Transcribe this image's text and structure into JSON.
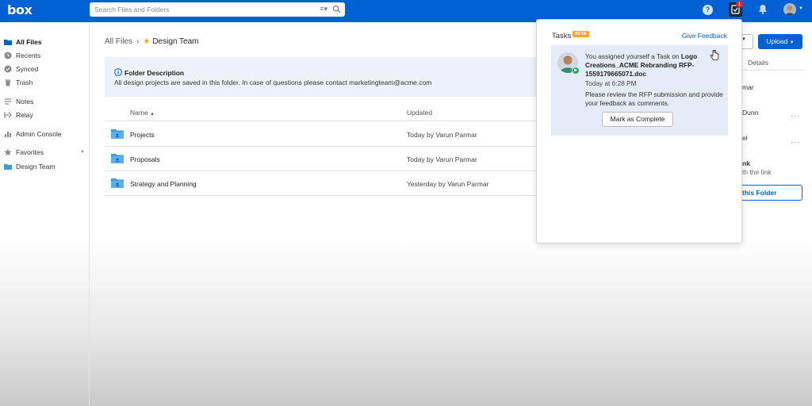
{
  "header": {
    "logo": "box",
    "search_placeholder": "Search Files and Folders",
    "tasks_count": "1",
    "help_label": "?"
  },
  "sidebar": {
    "items": [
      {
        "label": "All Files",
        "icon": "folder-icon",
        "active": true
      },
      {
        "label": "Recents",
        "icon": "clock-icon"
      },
      {
        "label": "Synced",
        "icon": "check-circle-icon"
      },
      {
        "label": "Trash",
        "icon": "trash-icon"
      },
      {
        "label": "Notes",
        "icon": "notes-icon"
      },
      {
        "label": "Relay",
        "icon": "relay-icon"
      },
      {
        "label": "Admin Console",
        "icon": "bar-chart-icon"
      },
      {
        "label": "Favorites",
        "icon": "star-icon"
      },
      {
        "label": "Design Team",
        "icon": "folder-icon"
      }
    ]
  },
  "breadcrumb": {
    "root": "All Files",
    "current": "Design Team"
  },
  "folder_description": {
    "title": "Folder Description",
    "text": "All design projects are saved in this folder. In case of questions please contact marketingteam@acme.com"
  },
  "table": {
    "columns": {
      "name": "Name",
      "updated": "Updated"
    },
    "rows": [
      {
        "name": "Projects",
        "updated": "Today by Varun Parmar"
      },
      {
        "name": "Proposals",
        "updated": "Today by Varun Parmar"
      },
      {
        "name": "Strategy and Planning",
        "updated": "Yesterday by Varun Parmar"
      }
    ]
  },
  "right_panel": {
    "upload_label": "Upload",
    "details_tab": "Details",
    "peek_1": "mar",
    "peek_2": "Dunn",
    "peek_3": "el",
    "peek_4": "nk",
    "peek_5": "th the link",
    "share_button": "this Folder"
  },
  "tasks_popover": {
    "title": "Tasks",
    "beta_badge": "BETA",
    "feedback_link": "Give Feedback",
    "task": {
      "prefix": "You assigned yourself a Task on ",
      "file": "Logo Creations_ACME Rebranding RFP-1559179665071.doc",
      "time": "Today at 6:28 PM",
      "message": "Please review the RFP submission and provide your feedback as comments.",
      "action": "Mark as Complete"
    }
  },
  "colors": {
    "brand": "#0061d5",
    "beta": "#f5a623",
    "badge": "#e0252b",
    "task_card": "#e3ecf8"
  }
}
